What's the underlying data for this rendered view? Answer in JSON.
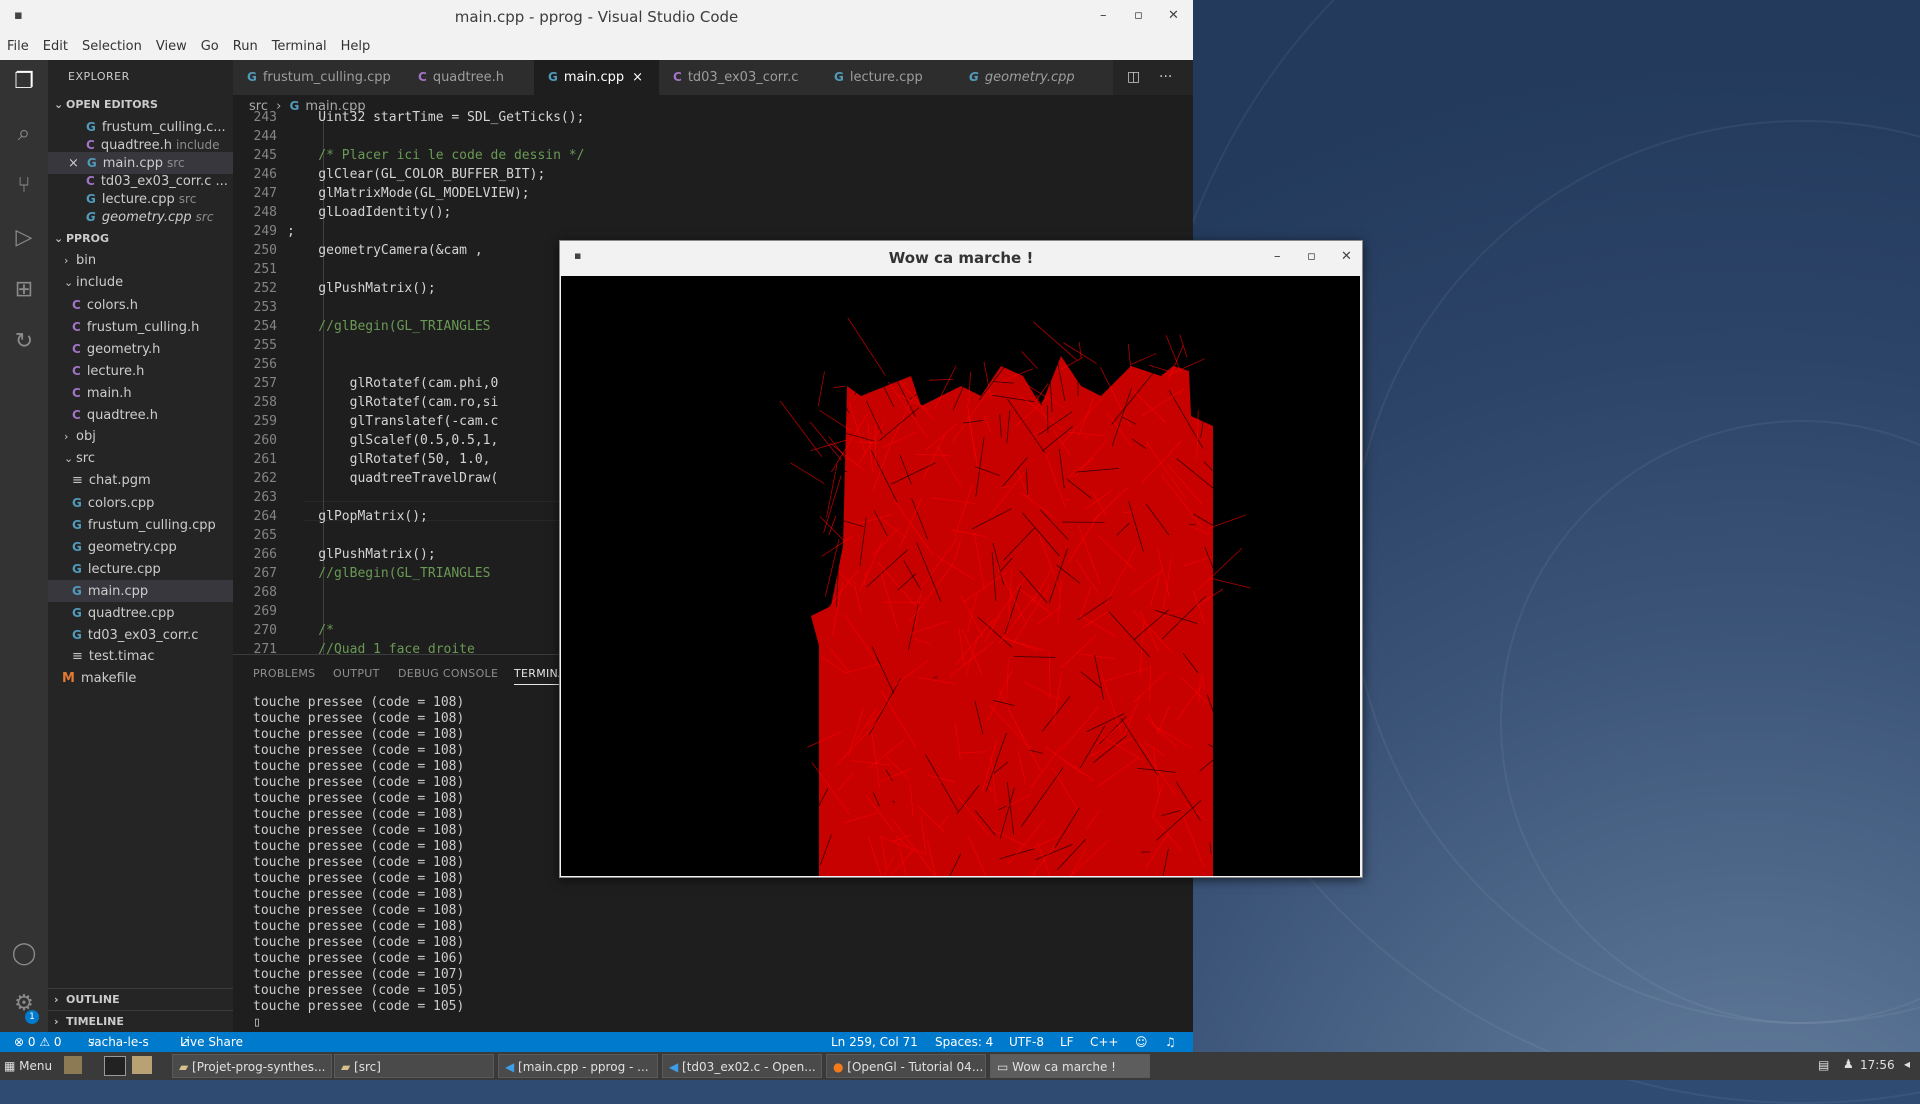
{
  "vscode": {
    "window_title": "main.cpp - pprog - Visual Studio Code",
    "menu": [
      "File",
      "Edit",
      "Selection",
      "View",
      "Go",
      "Run",
      "Terminal",
      "Help"
    ],
    "explorer_title": "EXPLORER",
    "open_editors_title": "OPEN EDITORS",
    "open_editors": [
      {
        "name": "frustum_culling.c...",
        "sub": "",
        "icon": "cpp"
      },
      {
        "name": "quadtree.h",
        "sub": "include",
        "icon": "c"
      },
      {
        "name": "main.cpp",
        "sub": "src",
        "icon": "cpp",
        "close": "×"
      },
      {
        "name": "td03_ex03_corr.c ...",
        "sub": "",
        "icon": "c"
      },
      {
        "name": "lecture.cpp",
        "sub": "src",
        "icon": "cpp"
      },
      {
        "name": "geometry.cpp",
        "sub": "src",
        "icon": "cpp"
      }
    ],
    "project_title": "PPROG",
    "tree": [
      {
        "name": "bin",
        "type": "folder"
      },
      {
        "name": "include",
        "type": "folder-open"
      },
      {
        "name": "colors.h",
        "type": "c"
      },
      {
        "name": "frustum_culling.h",
        "type": "c"
      },
      {
        "name": "geometry.h",
        "type": "c"
      },
      {
        "name": "lecture.h",
        "type": "c"
      },
      {
        "name": "main.h",
        "type": "c"
      },
      {
        "name": "quadtree.h",
        "type": "c"
      },
      {
        "name": "obj",
        "type": "folder"
      },
      {
        "name": "src",
        "type": "folder-open"
      },
      {
        "name": "chat.pgm",
        "type": "file"
      },
      {
        "name": "colors.cpp",
        "type": "cpp"
      },
      {
        "name": "frustum_culling.cpp",
        "type": "cpp"
      },
      {
        "name": "geometry.cpp",
        "type": "cpp"
      },
      {
        "name": "lecture.cpp",
        "type": "cpp"
      },
      {
        "name": "main.cpp",
        "type": "cpp"
      },
      {
        "name": "quadtree.cpp",
        "type": "cpp"
      },
      {
        "name": "td03_ex03_corr.c",
        "type": "cpp"
      },
      {
        "name": "test.timac",
        "type": "file"
      },
      {
        "name": "makefile",
        "type": "make"
      }
    ],
    "outline": "OUTLINE",
    "timeline": "TIMELINE",
    "tabs": [
      "frustum_culling.cpp",
      "quadtree.h",
      "main.cpp",
      "td03_ex03_corr.c",
      "lecture.cpp",
      "geometry.cpp"
    ],
    "active_tab": "main.cpp",
    "tab_close": "×",
    "breadcrumb": [
      "src",
      "main.cpp"
    ],
    "code_lines": [
      {
        "n": "243",
        "t": "    Uint32 startTime = SDL_GetTicks();"
      },
      {
        "n": "244",
        "t": ""
      },
      {
        "n": "245",
        "t": "    /* Placer ici le code de dessin */"
      },
      {
        "n": "246",
        "t": "    glClear(GL_COLOR_BUFFER_BIT);"
      },
      {
        "n": "247",
        "t": "    glMatrixMode(GL_MODELVIEW);"
      },
      {
        "n": "248",
        "t": "    glLoadIdentity();"
      },
      {
        "n": "249",
        "t": ";"
      },
      {
        "n": "250",
        "t": "    geometryCamera(&cam ,"
      },
      {
        "n": "251",
        "t": ""
      },
      {
        "n": "252",
        "t": "    glPushMatrix();"
      },
      {
        "n": "253",
        "t": ""
      },
      {
        "n": "254",
        "t": "    //glBegin(GL_TRIANGLES"
      },
      {
        "n": "255",
        "t": ""
      },
      {
        "n": "256",
        "t": ""
      },
      {
        "n": "257",
        "t": "        glRotatef(cam.phi,0"
      },
      {
        "n": "258",
        "t": "        glRotatef(cam.ro,si"
      },
      {
        "n": "259",
        "t": "        glTranslatef(-cam.c"
      },
      {
        "n": "260",
        "t": "        glScalef(0.5,0.5,1,"
      },
      {
        "n": "261",
        "t": "        glRotatef(50, 1.0,"
      },
      {
        "n": "262",
        "t": "        quadtreeTravelDraw("
      },
      {
        "n": "263",
        "t": ""
      },
      {
        "n": "264",
        "t": "    glPopMatrix();"
      },
      {
        "n": "265",
        "t": ""
      },
      {
        "n": "266",
        "t": "    glPushMatrix();"
      },
      {
        "n": "267",
        "t": "    //glBegin(GL_TRIANGLES"
      },
      {
        "n": "268",
        "t": ""
      },
      {
        "n": "269",
        "t": ""
      },
      {
        "n": "270",
        "t": "    /*"
      },
      {
        "n": "271",
        "t": "    //Quad 1 face droite"
      }
    ],
    "panel_tabs": [
      "PROBLEMS",
      "OUTPUT",
      "DEBUG CONSOLE",
      "TERMINAL"
    ],
    "terminal_lines": [
      "touche pressee (code = 108)",
      "touche pressee (code = 108)",
      "touche pressee (code = 108)",
      "touche pressee (code = 108)",
      "touche pressee (code = 108)",
      "touche pressee (code = 108)",
      "touche pressee (code = 108)",
      "touche pressee (code = 108)",
      "touche pressee (code = 108)",
      "touche pressee (code = 108)",
      "touche pressee (code = 108)",
      "touche pressee (code = 108)",
      "touche pressee (code = 108)",
      "touche pressee (code = 108)",
      "touche pressee (code = 108)",
      "touche pressee (code = 108)",
      "touche pressee (code = 106)",
      "touche pressee (code = 107)",
      "touche pressee (code = 105)",
      "touche pressee (code = 105)"
    ],
    "status": {
      "errors": "⊗ 0 ⚠ 0",
      "branch": "sacha-le-s",
      "liveshare": "Live Share",
      "position": "Ln 259, Col 71",
      "spaces": "Spaces: 4",
      "encoding": "UTF-8",
      "eol": "LF",
      "language": "C++"
    },
    "accounts_badge": "1"
  },
  "gl_window": {
    "title": "Wow ca marche !"
  },
  "taskbar": {
    "menu": "Menu",
    "items": [
      "[Projet-prog-synthes...",
      "[src]",
      "[main.cpp - pprog - ...",
      "[td03_ex02.c - Open...",
      "[OpenGl - Tutorial 04...",
      "Wow ca marche !"
    ],
    "clock": "17:56"
  },
  "colors": {
    "status_bar": "#007acc",
    "render": "#ff0000"
  }
}
